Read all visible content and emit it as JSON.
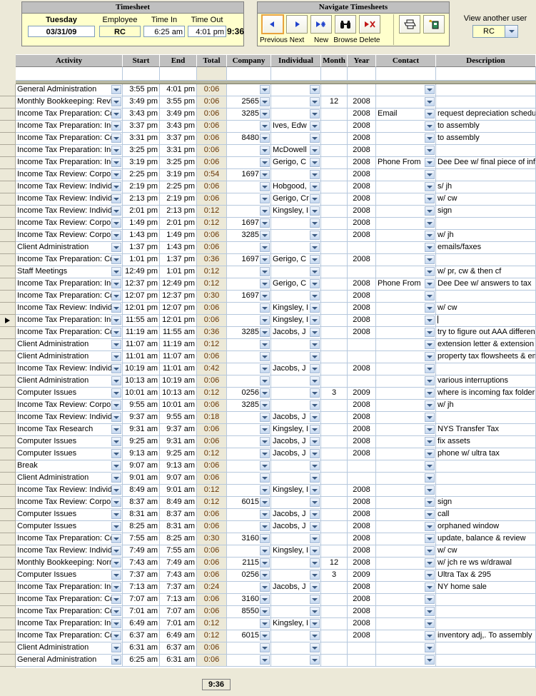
{
  "timesheet": {
    "title": "Timesheet",
    "day_label": "Tuesday",
    "date_value": "03/31/09",
    "employee_label": "Employee",
    "employee_value": "RC",
    "time_in_label": "Time In",
    "time_in_value": "6:25 am",
    "time_out_label": "Time Out",
    "time_out_value": "4:01 pm",
    "total_hours": "9:36"
  },
  "navigate": {
    "title": "Navigate Timesheets",
    "buttons": [
      {
        "label": "Previous",
        "icon": "left-triangle-icon"
      },
      {
        "label": "Next",
        "icon": "right-triangle-icon"
      },
      {
        "label": "New",
        "icon": "new-record-icon"
      },
      {
        "label": "Browse",
        "icon": "binoculars-icon"
      },
      {
        "label": "Delete",
        "icon": "delete-record-icon"
      }
    ],
    "print_icon": "printer-icon",
    "export_icon": "export-icon"
  },
  "view_user": {
    "label": "View another user",
    "value": "RC"
  },
  "grid": {
    "columns": [
      {
        "key": "activity",
        "label": "Activity"
      },
      {
        "key": "start",
        "label": "Start"
      },
      {
        "key": "end",
        "label": "End"
      },
      {
        "key": "total",
        "label": "Total"
      },
      {
        "key": "company",
        "label": "Company"
      },
      {
        "key": "individual",
        "label": "Individual"
      },
      {
        "key": "month",
        "label": "Month"
      },
      {
        "key": "year",
        "label": "Year"
      },
      {
        "key": "contact",
        "label": "Contact"
      },
      {
        "key": "description",
        "label": "Description"
      }
    ],
    "filter_row": {
      "activity": "",
      "start": "",
      "end": "",
      "total": "",
      "company": "",
      "individual": "",
      "month": "",
      "year": "",
      "contact": "",
      "description": ""
    },
    "selected_row_index": 19,
    "rows": [
      {
        "activity": "General Administration",
        "start": "3:55 pm",
        "end": "4:01 pm",
        "total": "0:06",
        "company": "",
        "individual": "",
        "month": "",
        "year": "",
        "contact": "",
        "description": ""
      },
      {
        "activity": "Monthly Bookkeeping: Revie",
        "start": "3:49 pm",
        "end": "3:55 pm",
        "total": "0:06",
        "company": "2565",
        "individual": "",
        "month": "12",
        "year": "2008",
        "contact": "",
        "description": ""
      },
      {
        "activity": "Income Tax Preparation: Cor",
        "start": "3:43 pm",
        "end": "3:49 pm",
        "total": "0:06",
        "company": "3285",
        "individual": "",
        "month": "",
        "year": "2008",
        "contact": "Email",
        "description": "request depreciation schedu"
      },
      {
        "activity": "Income Tax Preparation: Indi",
        "start": "3:37 pm",
        "end": "3:43 pm",
        "total": "0:06",
        "company": "",
        "individual": "Ives, Edw",
        "month": "",
        "year": "2008",
        "contact": "",
        "description": "to assembly"
      },
      {
        "activity": "Income Tax Preparation: Cor",
        "start": "3:31 pm",
        "end": "3:37 pm",
        "total": "0:06",
        "company": "8480",
        "individual": "",
        "month": "",
        "year": "2008",
        "contact": "",
        "description": "to assembly"
      },
      {
        "activity": "Income Tax Preparation: Indi",
        "start": "3:25 pm",
        "end": "3:31 pm",
        "total": "0:06",
        "company": "",
        "individual": "McDowell",
        "month": "",
        "year": "2008",
        "contact": "",
        "description": ""
      },
      {
        "activity": "Income Tax Preparation: Indi",
        "start": "3:19 pm",
        "end": "3:25 pm",
        "total": "0:06",
        "company": "",
        "individual": "Gerigo, C",
        "month": "",
        "year": "2008",
        "contact": "Phone From",
        "description": "Dee Dee w/ final piece of inf"
      },
      {
        "activity": "Income Tax Review: Corpora",
        "start": "2:25 pm",
        "end": "3:19 pm",
        "total": "0:54",
        "company": "1697",
        "individual": "",
        "month": "",
        "year": "2008",
        "contact": "",
        "description": ""
      },
      {
        "activity": "Income Tax Review: Individu",
        "start": "2:19 pm",
        "end": "2:25 pm",
        "total": "0:06",
        "company": "",
        "individual": "Hobgood,",
        "month": "",
        "year": "2008",
        "contact": "",
        "description": "s/ jh"
      },
      {
        "activity": "Income Tax Review: Individu",
        "start": "2:13 pm",
        "end": "2:19 pm",
        "total": "0:06",
        "company": "",
        "individual": "Gerigo, Cr",
        "month": "",
        "year": "2008",
        "contact": "",
        "description": "w/ cw"
      },
      {
        "activity": "Income Tax Review: Individu",
        "start": "2:01 pm",
        "end": "2:13 pm",
        "total": "0:12",
        "company": "",
        "individual": "Kingsley, I",
        "month": "",
        "year": "2008",
        "contact": "",
        "description": "sign"
      },
      {
        "activity": "Income Tax Review: Corpora",
        "start": "1:49 pm",
        "end": "2:01 pm",
        "total": "0:12",
        "company": "1697",
        "individual": "",
        "month": "",
        "year": "2008",
        "contact": "",
        "description": ""
      },
      {
        "activity": "Income Tax Review: Corpora",
        "start": "1:43 pm",
        "end": "1:49 pm",
        "total": "0:06",
        "company": "3285",
        "individual": "",
        "month": "",
        "year": "2008",
        "contact": "",
        "description": "w/ jh"
      },
      {
        "activity": "Client Administration",
        "start": "1:37 pm",
        "end": "1:43 pm",
        "total": "0:06",
        "company": "",
        "individual": "",
        "month": "",
        "year": "",
        "contact": "",
        "description": "emails/faxes"
      },
      {
        "activity": "Income Tax Preparation: Cor",
        "start": "1:01 pm",
        "end": "1:37 pm",
        "total": "0:36",
        "company": "1697",
        "individual": "Gerigo, C",
        "month": "",
        "year": "2008",
        "contact": "",
        "description": ""
      },
      {
        "activity": "Staff Meetings",
        "start": "12:49 pm",
        "end": "1:01 pm",
        "total": "0:12",
        "company": "",
        "individual": "",
        "month": "",
        "year": "",
        "contact": "",
        "description": "w/ pr, cw & then cf"
      },
      {
        "activity": "Income Tax Preparation: Indi",
        "start": "12:37 pm",
        "end": "12:49 pm",
        "total": "0:12",
        "company": "",
        "individual": "Gerigo, C",
        "month": "",
        "year": "2008",
        "contact": "Phone From",
        "description": "Dee Dee w/ answers to tax"
      },
      {
        "activity": "Income Tax Preparation: Cor",
        "start": "12:07 pm",
        "end": "12:37 pm",
        "total": "0:30",
        "company": "1697",
        "individual": "",
        "month": "",
        "year": "2008",
        "contact": "",
        "description": ""
      },
      {
        "activity": "Income Tax Review: Individu",
        "start": "12:01 pm",
        "end": "12:07 pm",
        "total": "0:06",
        "company": "",
        "individual": "Kingsley, I",
        "month": "",
        "year": "2008",
        "contact": "",
        "description": "w/ cw"
      },
      {
        "activity": "Income Tax Preparation: Indi",
        "start": "11:55 am",
        "end": "12:01 pm",
        "total": "0:06",
        "company": "",
        "individual": "Kingsley, I",
        "month": "",
        "year": "2008",
        "contact": "",
        "description": ""
      },
      {
        "activity": "Income Tax Preparation: Cor",
        "start": "11:19 am",
        "end": "11:55 am",
        "total": "0:36",
        "company": "3285",
        "individual": "Jacobs, J",
        "month": "",
        "year": "2008",
        "contact": "",
        "description": "try to figure out AAA differenc"
      },
      {
        "activity": "Client Administration",
        "start": "11:07 am",
        "end": "11:19 am",
        "total": "0:12",
        "company": "",
        "individual": "",
        "month": "",
        "year": "",
        "contact": "",
        "description": "extension letter & extension li"
      },
      {
        "activity": "Client Administration",
        "start": "11:01 am",
        "end": "11:07 am",
        "total": "0:06",
        "company": "",
        "individual": "",
        "month": "",
        "year": "",
        "contact": "",
        "description": "property tax flowsheets & em"
      },
      {
        "activity": "Income Tax Review: Individu",
        "start": "10:19 am",
        "end": "11:01 am",
        "total": "0:42",
        "company": "",
        "individual": "Jacobs, J",
        "month": "",
        "year": "2008",
        "contact": "",
        "description": ""
      },
      {
        "activity": "Client Administration",
        "start": "10:13 am",
        "end": "10:19 am",
        "total": "0:06",
        "company": "",
        "individual": "",
        "month": "",
        "year": "",
        "contact": "",
        "description": "various interruptions"
      },
      {
        "activity": "Computer Issues",
        "start": "10:01 am",
        "end": "10:13 am",
        "total": "0:12",
        "company": "0256",
        "individual": "",
        "month": "3",
        "year": "2009",
        "contact": "",
        "description": "where is incoming fax folder?"
      },
      {
        "activity": "Income Tax Review: Corpora",
        "start": "9:55 am",
        "end": "10:01 am",
        "total": "0:06",
        "company": "3285",
        "individual": "",
        "month": "",
        "year": "2008",
        "contact": "",
        "description": "w/ jh"
      },
      {
        "activity": "Income Tax Review: Individu",
        "start": "9:37 am",
        "end": "9:55 am",
        "total": "0:18",
        "company": "",
        "individual": "Jacobs, J",
        "month": "",
        "year": "2008",
        "contact": "",
        "description": ""
      },
      {
        "activity": "Income Tax Research",
        "start": "9:31 am",
        "end": "9:37 am",
        "total": "0:06",
        "company": "",
        "individual": "Kingsley, I",
        "month": "",
        "year": "2008",
        "contact": "",
        "description": "NYS Transfer Tax"
      },
      {
        "activity": "Computer Issues",
        "start": "9:25 am",
        "end": "9:31 am",
        "total": "0:06",
        "company": "",
        "individual": "Jacobs, J",
        "month": "",
        "year": "2008",
        "contact": "",
        "description": "fix assets"
      },
      {
        "activity": "Computer Issues",
        "start": "9:13 am",
        "end": "9:25 am",
        "total": "0:12",
        "company": "",
        "individual": "Jacobs, J",
        "month": "",
        "year": "2008",
        "contact": "",
        "description": "phone w/ ultra tax"
      },
      {
        "activity": "Break",
        "start": "9:07 am",
        "end": "9:13 am",
        "total": "0:06",
        "company": "",
        "individual": "",
        "month": "",
        "year": "",
        "contact": "",
        "description": ""
      },
      {
        "activity": "Client Administration",
        "start": "9:01 am",
        "end": "9:07 am",
        "total": "0:06",
        "company": "",
        "individual": "",
        "month": "",
        "year": "",
        "contact": "",
        "description": ""
      },
      {
        "activity": "Income Tax Review: Individu",
        "start": "8:49 am",
        "end": "9:01 am",
        "total": "0:12",
        "company": "",
        "individual": "Kingsley, I",
        "month": "",
        "year": "2008",
        "contact": "",
        "description": ""
      },
      {
        "activity": "Income Tax Review: Corpora",
        "start": "8:37 am",
        "end": "8:49 am",
        "total": "0:12",
        "company": "6015",
        "individual": "",
        "month": "",
        "year": "2008",
        "contact": "",
        "description": "sign"
      },
      {
        "activity": "Computer Issues",
        "start": "8:31 am",
        "end": "8:37 am",
        "total": "0:06",
        "company": "",
        "individual": "Jacobs, J",
        "month": "",
        "year": "2008",
        "contact": "",
        "description": "call"
      },
      {
        "activity": "Computer Issues",
        "start": "8:25 am",
        "end": "8:31 am",
        "total": "0:06",
        "company": "",
        "individual": "Jacobs, J",
        "month": "",
        "year": "2008",
        "contact": "",
        "description": "orphaned window"
      },
      {
        "activity": "Income Tax Preparation: Cor",
        "start": "7:55 am",
        "end": "8:25 am",
        "total": "0:30",
        "company": "3160",
        "individual": "",
        "month": "",
        "year": "2008",
        "contact": "",
        "description": "update, balance & review"
      },
      {
        "activity": "Income Tax Review: Individu",
        "start": "7:49 am",
        "end": "7:55 am",
        "total": "0:06",
        "company": "",
        "individual": "Kingsley, I",
        "month": "",
        "year": "2008",
        "contact": "",
        "description": "w/ cw"
      },
      {
        "activity": "Monthly Bookkeeping: Norma",
        "start": "7:43 am",
        "end": "7:49 am",
        "total": "0:06",
        "company": "2115",
        "individual": "",
        "month": "12",
        "year": "2008",
        "contact": "",
        "description": "w/ jch re ws w/drawal"
      },
      {
        "activity": "Computer Issues",
        "start": "7:37 am",
        "end": "7:43 am",
        "total": "0:06",
        "company": "0256",
        "individual": "",
        "month": "3",
        "year": "2009",
        "contact": "",
        "description": "Ultra Tax & 295"
      },
      {
        "activity": "Income Tax Preparation: Indi",
        "start": "7:13 am",
        "end": "7:37 am",
        "total": "0:24",
        "company": "",
        "individual": "Jacobs, J",
        "month": "",
        "year": "2008",
        "contact": "",
        "description": "NY home sale"
      },
      {
        "activity": "Income Tax Preparation: Cor",
        "start": "7:07 am",
        "end": "7:13 am",
        "total": "0:06",
        "company": "3160",
        "individual": "",
        "month": "",
        "year": "2008",
        "contact": "",
        "description": ""
      },
      {
        "activity": "Income Tax Preparation: Cor",
        "start": "7:01 am",
        "end": "7:07 am",
        "total": "0:06",
        "company": "8550",
        "individual": "",
        "month": "",
        "year": "2008",
        "contact": "",
        "description": ""
      },
      {
        "activity": "Income Tax Preparation: Indi",
        "start": "6:49 am",
        "end": "7:01 am",
        "total": "0:12",
        "company": "",
        "individual": "Kingsley, I",
        "month": "",
        "year": "2008",
        "contact": "",
        "description": ""
      },
      {
        "activity": "Income Tax Preparation: Cor",
        "start": "6:37 am",
        "end": "6:49 am",
        "total": "0:12",
        "company": "6015",
        "individual": "",
        "month": "",
        "year": "2008",
        "contact": "",
        "description": "inventory adj,. To assembly"
      },
      {
        "activity": "Client Administration",
        "start": "6:31 am",
        "end": "6:37 am",
        "total": "0:06",
        "company": "",
        "individual": "",
        "month": "",
        "year": "",
        "contact": "",
        "description": ""
      },
      {
        "activity": "General Administration",
        "start": "6:25 am",
        "end": "6:31 am",
        "total": "0:06",
        "company": "",
        "individual": "",
        "month": "",
        "year": "",
        "contact": "",
        "description": ""
      }
    ]
  },
  "footer": {
    "total": "9:36"
  }
}
